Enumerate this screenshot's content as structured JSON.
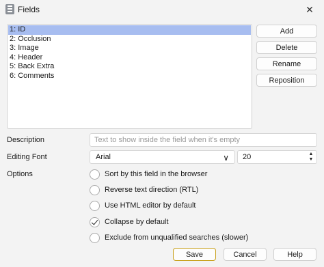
{
  "window": {
    "title": "Fields",
    "close_glyph": "✕"
  },
  "fields_list": {
    "items": [
      "1: ID",
      "2: Occlusion",
      "3: Image",
      "4: Header",
      "5: Back Extra",
      "6: Comments"
    ],
    "selected_index": 0
  },
  "side_buttons": {
    "add": "Add",
    "delete": "Delete",
    "rename": "Rename",
    "reposition": "Reposition"
  },
  "description": {
    "label": "Description",
    "placeholder": "Text to show inside the field when it's empty"
  },
  "editing_font": {
    "label": "Editing Font",
    "font": "Arial",
    "size": "20"
  },
  "options": {
    "label": "Options",
    "items": [
      {
        "label": "Sort by this field in the browser",
        "checked": false
      },
      {
        "label": "Reverse text direction (RTL)",
        "checked": false
      },
      {
        "label": "Use HTML editor by default",
        "checked": false
      },
      {
        "label": "Collapse by default",
        "checked": true
      },
      {
        "label": "Exclude from unqualified searches (slower)",
        "checked": false
      }
    ]
  },
  "footer": {
    "save": "Save",
    "cancel": "Cancel",
    "help": "Help"
  }
}
